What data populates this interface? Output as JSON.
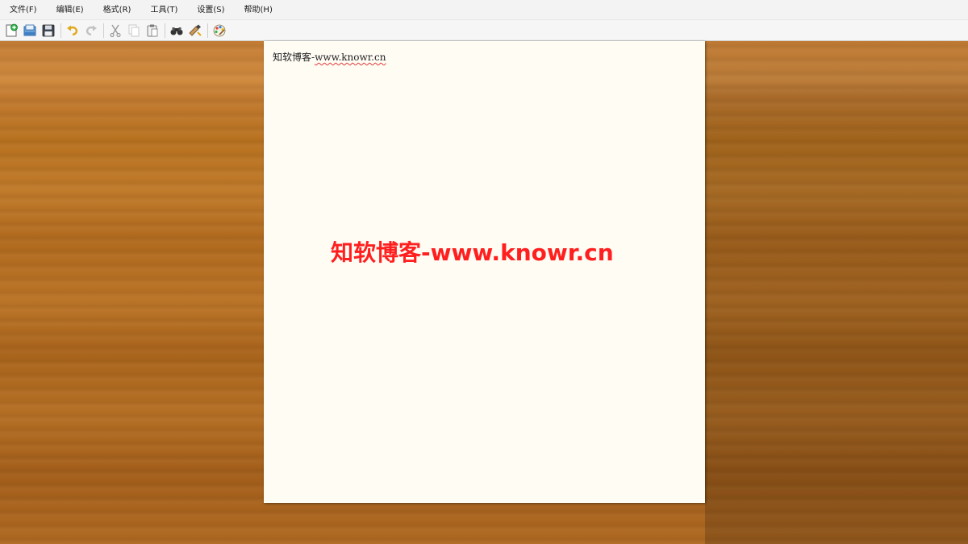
{
  "menu": {
    "items": [
      "文件(F)",
      "编辑(E)",
      "格式(R)",
      "工具(T)",
      "设置(S)",
      "帮助(H)"
    ]
  },
  "toolbar": {
    "icons": [
      "new-document-icon",
      "open-icon",
      "save-icon",
      "undo-icon",
      "redo-icon",
      "cut-icon",
      "copy-icon",
      "paste-icon",
      "find-icon",
      "replace-icon",
      "color-palette-icon"
    ]
  },
  "document": {
    "prefix": "知软博客-",
    "url_text": "www.knowr.cn"
  },
  "watermark": {
    "text": "知软博客-www.knowr.cn",
    "color": "#ff1f1f"
  },
  "colors": {
    "paper": "#fffcf4",
    "desk": "#b06a22"
  }
}
